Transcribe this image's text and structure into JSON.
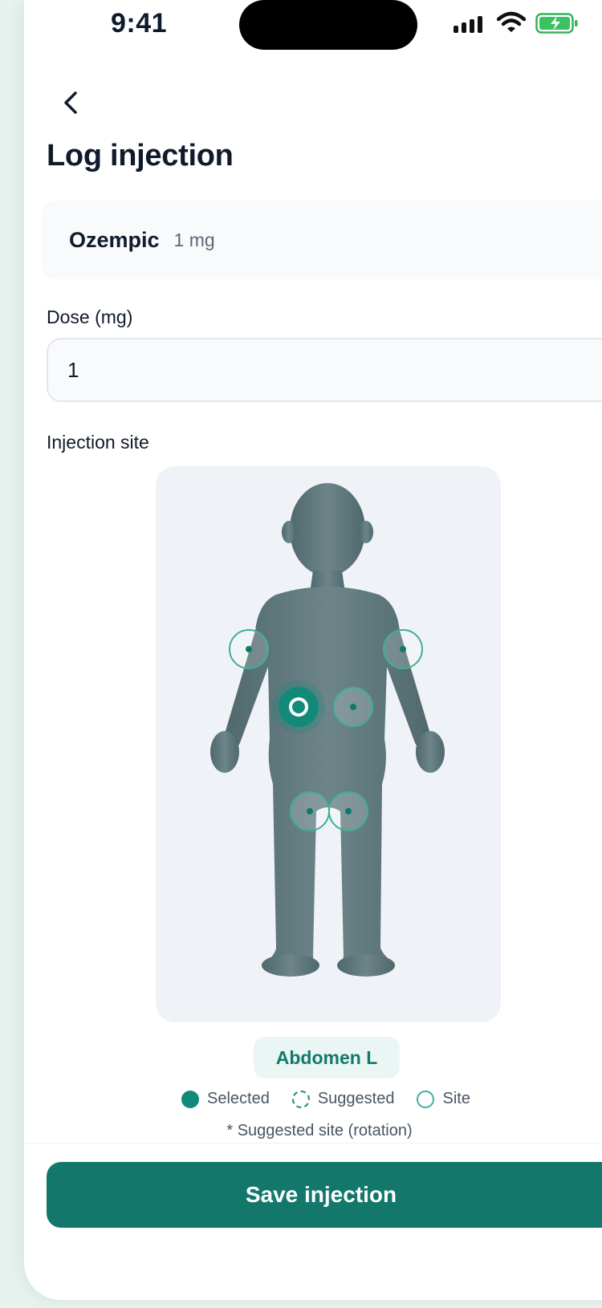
{
  "status_bar": {
    "time": "9:41"
  },
  "header": {
    "title": "Log injection"
  },
  "medication": {
    "name": "Ozempic",
    "dose": "1 mg"
  },
  "dose_field": {
    "label": "Dose (mg)",
    "value": "1"
  },
  "injection_site": {
    "label": "Injection site",
    "selected_site": "Abdomen L",
    "sites": [
      {
        "id": "arm-right",
        "selected": false
      },
      {
        "id": "arm-left",
        "selected": false
      },
      {
        "id": "abdomen-left",
        "selected": true
      },
      {
        "id": "abdomen-right",
        "selected": false
      },
      {
        "id": "thigh-right",
        "selected": false
      },
      {
        "id": "thigh-left",
        "selected": false
      }
    ]
  },
  "legend": {
    "selected": "Selected",
    "suggested": "Suggested",
    "site": "Site"
  },
  "footnote": "* Suggested site (rotation)",
  "actions": {
    "save_label": "Save injection"
  },
  "colors": {
    "accent": "#13786b",
    "site_ring": "#3fae9b",
    "body": "#617a7e"
  }
}
